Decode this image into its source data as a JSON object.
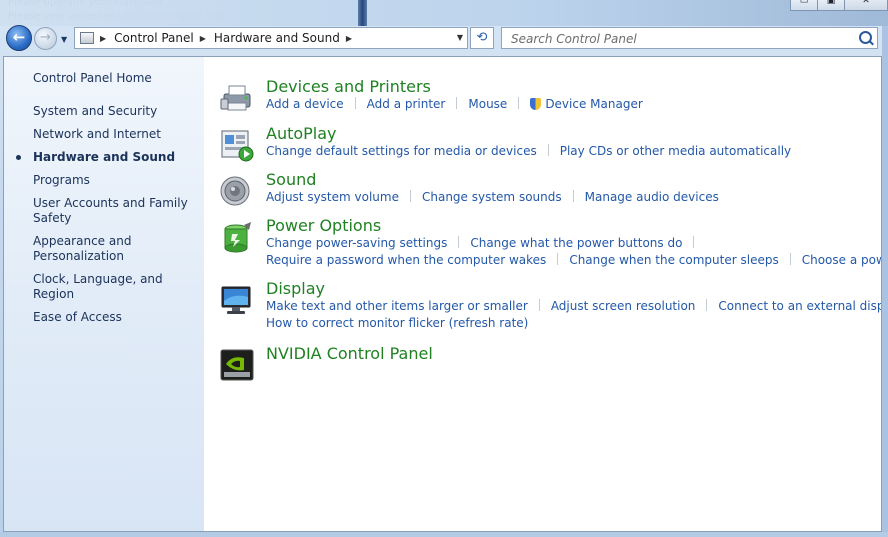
{
  "chrome": {
    "ghost_line1": "Please upgrade your Flash app",
    "ghost_line2": "Please your accepted self-upload issue Table",
    "minimize_glyph": "▭",
    "maximize_glyph": "▣",
    "close_glyph": "✕"
  },
  "nav": {
    "back_glyph": "←",
    "forward_glyph": "→",
    "history_glyph": "▼",
    "refresh_glyph": "⟲",
    "breadcrumbs": [
      "Control Panel",
      "Hardware and Sound"
    ],
    "crumb_arrow": "▶",
    "dropdown_glyph": "▼",
    "search_placeholder": "Search Control Panel"
  },
  "sidebar": {
    "home": "Control Panel Home",
    "items": [
      {
        "label": "System and Security",
        "active": false
      },
      {
        "label": "Network and Internet",
        "active": false
      },
      {
        "label": "Hardware and Sound",
        "active": true
      },
      {
        "label": "Programs",
        "active": false
      },
      {
        "label": "User Accounts and Family Safety",
        "active": false
      },
      {
        "label": "Appearance and Personalization",
        "active": false
      },
      {
        "label": "Clock, Language, and Region",
        "active": false
      },
      {
        "label": "Ease of Access",
        "active": false
      }
    ]
  },
  "categories": [
    {
      "title": "Devices and Printers",
      "icon": "printer-icon",
      "rows": [
        [
          "Add a device",
          "Add a printer",
          "Mouse",
          "Device Manager"
        ]
      ]
    },
    {
      "title": "AutoPlay",
      "icon": "autoplay-icon",
      "rows": [
        [
          "Change default settings for media or devices",
          "Play CDs or other media automatically"
        ]
      ]
    },
    {
      "title": "Sound",
      "icon": "speaker-icon",
      "rows": [
        [
          "Adjust system volume",
          "Change system sounds",
          "Manage audio devices"
        ]
      ]
    },
    {
      "title": "Power Options",
      "icon": "battery-icon",
      "rows": [
        [
          "Change power-saving settings",
          "Change what the power buttons do"
        ],
        [
          "Require a password when the computer wakes",
          "Change when the computer sleeps",
          "Choose a power plan"
        ]
      ]
    },
    {
      "title": "Display",
      "icon": "monitor-icon",
      "rows": [
        [
          "Make text and other items larger or smaller",
          "Adjust screen resolution",
          "Connect to an external display"
        ],
        [
          "How to correct monitor flicker (refresh rate)"
        ]
      ]
    },
    {
      "title": "NVIDIA Control Panel",
      "icon": "nvidia-icon",
      "rows": []
    }
  ]
}
